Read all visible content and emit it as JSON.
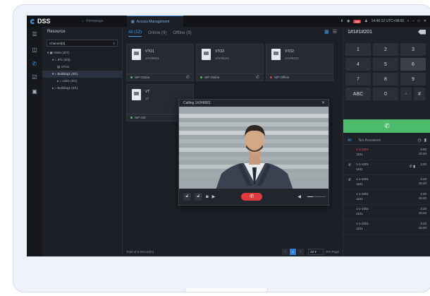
{
  "app": {
    "logo": "DSS",
    "tabs": [
      {
        "label": "Homepage",
        "icon": "home-icon"
      },
      {
        "label": "Access Management",
        "icon": "grid-icon"
      }
    ],
    "status_badge": "888",
    "time": "14:46:32 UTC+08:00"
  },
  "sidebar": {
    "icons": [
      "menu-icon",
      "book-icon",
      "phone-icon",
      "calendar-check-icon",
      "monitor-icon"
    ]
  },
  "tree": {
    "title": "Resource",
    "search_value": "Channel(3)",
    "nodes": [
      {
        "label": "Video (4/7)",
        "level": 0,
        "toggle": "▾",
        "icon": "▣"
      },
      {
        "label": "IPC (0/3)",
        "level": 1,
        "toggle": "▾",
        "icon": "⌂"
      },
      {
        "label": "VTO1",
        "level": 2,
        "toggle": "",
        "icon": "▤"
      },
      {
        "label": "Building1 (0/1)",
        "level": 1,
        "toggle": "▾",
        "icon": "⌂",
        "selected": true
      },
      {
        "label": "Unit1 (0/1)",
        "level": 2,
        "toggle": "▸",
        "icon": "⌂"
      },
      {
        "label": "Building1 (0/1)",
        "level": 1,
        "toggle": "▸",
        "icon": "⌂"
      }
    ]
  },
  "main": {
    "filters": [
      {
        "label": "All (12)",
        "active": true
      },
      {
        "label": "Online (9)",
        "active": false
      },
      {
        "label": "Offline (3)",
        "active": false
      }
    ],
    "cards": [
      {
        "name": "VTO1",
        "number": "1#1#8001",
        "status": "SIP Online",
        "status_color": "#4cbb6c",
        "action": "phone"
      },
      {
        "name": "VTO2",
        "number": "1#1#8101",
        "status": "SIP Online",
        "status_color": "#4cbb6c",
        "action": "phone"
      },
      {
        "name": "VTO2",
        "number": "1#1#8101",
        "status": "SIP Offline",
        "status_color": "#e0393e",
        "action": "none"
      },
      {
        "name": "VT",
        "number": "1#",
        "status": "SIP Onl",
        "status_color": "#4cbb6c",
        "action": "none"
      }
    ],
    "pager": {
      "total_text": "Total of 5 Record(s)",
      "page": "1",
      "per_page": "20",
      "per_page_label": "Per Page"
    }
  },
  "call_dialog": {
    "title": "Calling 1#2#8001"
  },
  "dial": {
    "display": "1#1#1#201",
    "keys": [
      "1",
      "2",
      "3",
      "4",
      "5",
      "6",
      "7",
      "8",
      "9",
      "ABC",
      "0",
      "-",
      "#"
    ],
    "active_key": "6",
    "record_tabs": [
      {
        "label": "All",
        "active": true
      },
      {
        "label": "Not Answered",
        "active": false
      }
    ],
    "records": [
      {
        "number": "1-1-1001",
        "name": "1101",
        "date": "3.00",
        "time": "15:40",
        "missed": true,
        "outgoing": false,
        "actions": false
      },
      {
        "number": "1-1-1001",
        "name": "1101",
        "date": "3.00",
        "time": "",
        "missed": false,
        "outgoing": true,
        "actions": true
      },
      {
        "number": "1-1-1001",
        "name": "1101",
        "date": "3.20",
        "time": "15:40",
        "missed": false,
        "outgoing": true,
        "actions": false
      },
      {
        "number": "1-1-1001",
        "name": "1101",
        "date": "3.20",
        "time": "15:40",
        "missed": false,
        "outgoing": false,
        "actions": false
      },
      {
        "number": "1-1-1001",
        "name": "1101",
        "date": "3.20",
        "time": "15:40",
        "missed": false,
        "outgoing": false,
        "actions": false
      },
      {
        "number": "1-1-1001",
        "name": "1101",
        "date": "3.20",
        "time": "15:40",
        "missed": false,
        "outgoing": false,
        "actions": false
      }
    ]
  }
}
